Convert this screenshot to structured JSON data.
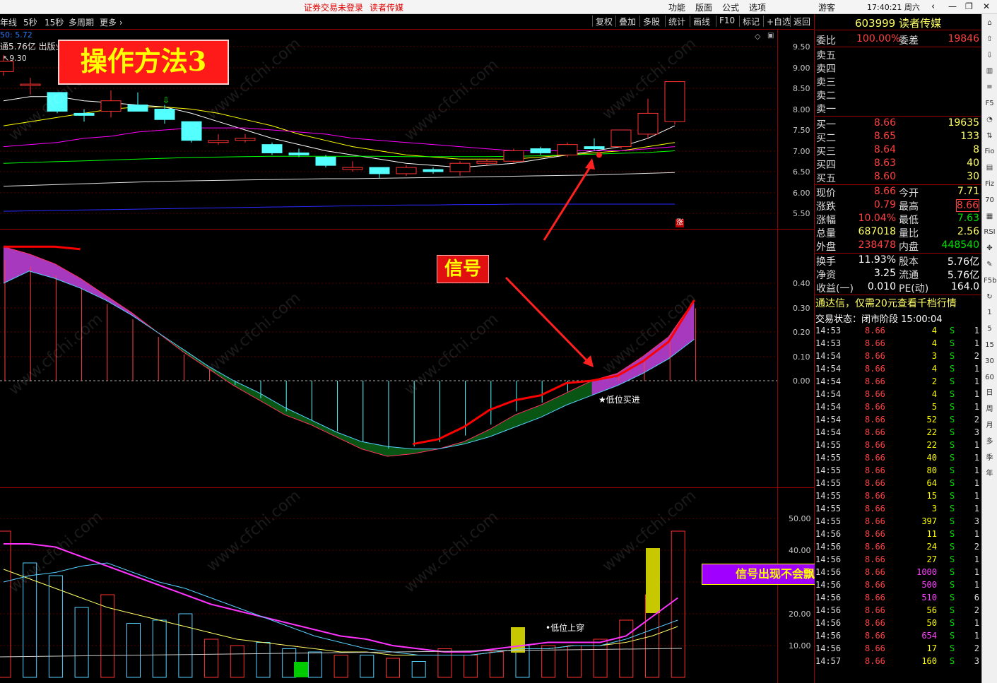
{
  "topbar": {
    "login_status": "证券交易未登录",
    "stock_short": "读者传媒",
    "menu": [
      "功能",
      "版面",
      "公式",
      "选项"
    ],
    "user": "游客",
    "clock": "17:40:21 周六"
  },
  "toolbar": {
    "left_items": [
      "年线",
      "5秒",
      "15秒",
      "多周期",
      "更多 ›"
    ],
    "right_items": [
      "复权",
      "叠加",
      "多股",
      "统计",
      "画线",
      "F10",
      "标记",
      "+自选",
      "返回"
    ]
  },
  "chart_header": {
    "line1": "50: 5.72",
    "line2": "通5.76亿 出版业",
    "line3": "9.30"
  },
  "annotations": {
    "title": "操作方法3",
    "signal": "信号",
    "buy_label": "★低位买进",
    "cross_label": "•低位上穿",
    "caption": "信号出现不会飘移，然后观察成交量的变化",
    "limit_up_mark": "涨"
  },
  "watermark": "www.cfchi.com",
  "colors": {
    "up": "#ff3232",
    "down": "#54ffff",
    "green": "#00ff00",
    "yellow": "#ffff00",
    "magenta": "#ff00ff",
    "purple_band": "#b03cc8",
    "green_band": "#0a5a14",
    "panel_red": "#9b0000"
  },
  "price_axis": [
    "9.50",
    "9.00",
    "8.50",
    "8.00",
    "7.50",
    "7.00",
    "6.50",
    "6.00",
    "5.50"
  ],
  "macd_axis": [
    "0.40",
    "0.30",
    "0.20",
    "0.10",
    "0.00"
  ],
  "vol_axis": [
    "50.00",
    "40.00",
    "30.00",
    "20.00",
    "10.00"
  ],
  "chart_data": {
    "type": "candlestick",
    "candles": [
      {
        "o": 8.9,
        "c": 9.15,
        "h": 9.3,
        "l": 8.8
      },
      {
        "o": 8.6,
        "c": 8.6,
        "h": 8.75,
        "l": 8.35
      },
      {
        "o": 8.4,
        "c": 7.95,
        "h": 8.4,
        "l": 7.9
      },
      {
        "o": 7.9,
        "c": 7.85,
        "h": 8.0,
        "l": 7.7
      },
      {
        "o": 7.95,
        "c": 8.2,
        "h": 8.45,
        "l": 7.8
      },
      {
        "o": 8.1,
        "c": 7.95,
        "h": 8.4,
        "l": 7.95
      },
      {
        "o": 8.0,
        "c": 7.75,
        "h": 8.1,
        "l": 7.65
      },
      {
        "o": 7.7,
        "c": 7.25,
        "h": 7.7,
        "l": 7.2
      },
      {
        "o": 7.2,
        "c": 7.25,
        "h": 7.4,
        "l": 7.15
      },
      {
        "o": 7.25,
        "c": 7.3,
        "h": 7.4,
        "l": 7.2
      },
      {
        "o": 7.15,
        "c": 6.95,
        "h": 7.2,
        "l": 6.9
      },
      {
        "o": 6.95,
        "c": 6.9,
        "h": 7.05,
        "l": 6.85
      },
      {
        "o": 6.85,
        "c": 6.65,
        "h": 6.9,
        "l": 6.6
      },
      {
        "o": 6.55,
        "c": 6.6,
        "h": 6.75,
        "l": 6.5
      },
      {
        "o": 6.6,
        "c": 6.45,
        "h": 6.6,
        "l": 6.35
      },
      {
        "o": 6.45,
        "c": 6.6,
        "h": 6.65,
        "l": 6.4
      },
      {
        "o": 6.55,
        "c": 6.5,
        "h": 6.6,
        "l": 6.45
      },
      {
        "o": 6.5,
        "c": 6.7,
        "h": 6.75,
        "l": 6.4
      },
      {
        "o": 6.7,
        "c": 6.75,
        "h": 6.8,
        "l": 6.65
      },
      {
        "o": 6.75,
        "c": 7.0,
        "h": 7.05,
        "l": 6.7
      },
      {
        "o": 7.05,
        "c": 6.95,
        "h": 7.1,
        "l": 6.9
      },
      {
        "o": 6.9,
        "c": 7.15,
        "h": 7.2,
        "l": 6.85
      },
      {
        "o": 7.1,
        "c": 7.05,
        "h": 7.3,
        "l": 7.0
      },
      {
        "o": 7.1,
        "c": 7.5,
        "h": 7.5,
        "l": 7.05
      },
      {
        "o": 7.4,
        "c": 7.9,
        "h": 8.25,
        "l": 7.3
      },
      {
        "o": 7.7,
        "c": 8.66,
        "h": 8.66,
        "l": 7.63
      }
    ],
    "ma": [
      {
        "color": "#ffffff",
        "values": [
          8.2,
          8.3,
          8.3,
          8.2,
          8.15,
          8.1,
          8.05,
          7.9,
          7.7,
          7.5,
          7.3,
          7.15,
          7.0,
          6.9,
          6.8,
          6.7,
          6.65,
          6.6,
          6.65,
          6.7,
          6.8,
          6.9,
          7.0,
          7.1,
          7.3,
          7.6
        ]
      },
      {
        "color": "#ffff00",
        "values": [
          7.6,
          7.7,
          7.8,
          7.9,
          8.0,
          8.05,
          8.05,
          8.0,
          7.9,
          7.75,
          7.6,
          7.4,
          7.25,
          7.1,
          7.0,
          6.9,
          6.85,
          6.8,
          6.8,
          6.8,
          6.85,
          6.9,
          6.95,
          7.0,
          7.1,
          7.2
        ]
      },
      {
        "color": "#ff00ff",
        "values": [
          7.1,
          7.15,
          7.2,
          7.3,
          7.35,
          7.45,
          7.5,
          7.55,
          7.55,
          7.55,
          7.5,
          7.45,
          7.4,
          7.3,
          7.25,
          7.2,
          7.15,
          7.1,
          7.05,
          7.0,
          7.0,
          7.0,
          7.0,
          7.0,
          7.05,
          7.1
        ]
      },
      {
        "color": "#00ff00",
        "values": [
          6.7,
          6.72,
          6.74,
          6.76,
          6.78,
          6.8,
          6.82,
          6.84,
          6.85,
          6.86,
          6.87,
          6.87,
          6.87,
          6.87,
          6.87,
          6.86,
          6.86,
          6.86,
          6.86,
          6.87,
          6.88,
          6.9,
          6.92,
          6.94,
          6.96,
          7.0
        ]
      },
      {
        "color": "#e0e0e0",
        "values": [
          6.15,
          6.17,
          6.19,
          6.21,
          6.23,
          6.25,
          6.27,
          6.28,
          6.29,
          6.3,
          6.31,
          6.32,
          6.33,
          6.33,
          6.34,
          6.35,
          6.36,
          6.37,
          6.38,
          6.39,
          6.4,
          6.41,
          6.42,
          6.44,
          6.46,
          6.48
        ]
      },
      {
        "color": "#2a2aff",
        "values": [
          5.55,
          5.56,
          5.57,
          5.58,
          5.59,
          5.6,
          5.61,
          5.62,
          5.63,
          5.64,
          5.65,
          5.66,
          5.67,
          5.68,
          5.69,
          5.7,
          5.7,
          5.71,
          5.71,
          5.72,
          5.72,
          5.72,
          5.72,
          5.72,
          5.72,
          5.72
        ]
      }
    ],
    "macd": {
      "red_line": [
        0.55,
        0.52,
        0.48,
        0.42,
        0.35,
        0.28,
        0.2,
        0.12,
        0.05,
        -0.02,
        -0.08,
        -0.14,
        -0.18,
        -0.23,
        -0.28,
        -0.31,
        -0.3,
        -0.28,
        -0.25,
        -0.2,
        -0.14,
        -0.1,
        -0.05,
        0.0,
        0.03,
        0.1,
        0.18,
        0.33
      ],
      "cyan_line": [
        0.4,
        0.45,
        0.42,
        0.38,
        0.33,
        0.27,
        0.2,
        0.13,
        0.06,
        0.0,
        -0.05,
        -0.11,
        -0.16,
        -0.21,
        -0.25,
        -0.27,
        -0.28,
        -0.28,
        -0.26,
        -0.23,
        -0.19,
        -0.15,
        -0.1,
        -0.06,
        -0.02,
        0.03,
        0.09,
        0.17
      ],
      "thick_red": [
        0.55,
        0.55,
        0.55,
        0.54
      ],
      "signal_line": [
        -0.26,
        -0.24,
        -0.19,
        -0.12,
        -0.08,
        -0.06,
        -0.01,
        0.0,
        0.02,
        0.08,
        0.16,
        0.33
      ]
    },
    "volume": {
      "bars": [
        {
          "v": 46,
          "up": true
        },
        {
          "v": 36,
          "up": false
        },
        {
          "v": 32,
          "up": false
        },
        {
          "v": 22,
          "up": false
        },
        {
          "v": 26,
          "up": true
        },
        {
          "v": 17,
          "up": false
        },
        {
          "v": 18,
          "up": false
        },
        {
          "v": 20,
          "up": false
        },
        {
          "v": 12,
          "up": true
        },
        {
          "v": 10,
          "up": true
        },
        {
          "v": 11,
          "up": false
        },
        {
          "v": 9,
          "up": false
        },
        {
          "v": 8,
          "up": false
        },
        {
          "v": 7,
          "up": true
        },
        {
          "v": 7,
          "up": false
        },
        {
          "v": 6,
          "up": true
        },
        {
          "v": 5,
          "up": false
        },
        {
          "v": 9,
          "up": true
        },
        {
          "v": 7,
          "up": true
        },
        {
          "v": 8,
          "up": true
        },
        {
          "v": 10,
          "up": false
        },
        {
          "v": 10,
          "up": true
        },
        {
          "v": 10,
          "up": true
        },
        {
          "v": 12,
          "up": true
        },
        {
          "v": 18,
          "up": true
        },
        {
          "v": 26,
          "up": true
        },
        {
          "v": 46,
          "up": true
        }
      ],
      "ma_magenta": [
        42,
        42,
        41,
        38,
        35,
        32,
        29,
        26,
        23,
        21,
        19,
        17,
        15,
        13,
        12,
        10,
        9,
        8,
        8,
        9,
        10,
        11,
        11,
        11,
        13,
        19,
        25
      ],
      "ma_yellow": [
        34,
        31,
        28,
        25,
        22,
        20,
        18,
        16,
        14,
        12,
        11,
        10,
        9,
        8,
        8,
        7,
        7,
        7,
        7,
        8,
        9,
        9,
        10,
        10,
        11,
        13,
        16
      ],
      "ma_cyan": [
        30,
        32,
        33,
        35,
        36,
        33,
        30,
        28,
        25,
        22,
        19,
        16,
        13,
        11,
        9,
        8,
        7,
        7,
        7,
        8,
        9,
        9,
        10,
        10,
        12,
        15,
        18
      ]
    }
  },
  "quote": {
    "code": "603999",
    "name": "读者传媒",
    "weibi_label": "委比",
    "weibi": "100.00%",
    "weicha_label": "委差",
    "weicha": "19846",
    "sells": [
      {
        "label": "卖五"
      },
      {
        "label": "卖四"
      },
      {
        "label": "卖三"
      },
      {
        "label": "卖二"
      },
      {
        "label": "卖一"
      }
    ],
    "buys": [
      {
        "label": "买一",
        "price": "8.66",
        "vol": "19635"
      },
      {
        "label": "买二",
        "price": "8.65",
        "vol": "133"
      },
      {
        "label": "买三",
        "price": "8.64",
        "vol": "8"
      },
      {
        "label": "买四",
        "price": "8.63",
        "vol": "40"
      },
      {
        "label": "买五",
        "price": "8.60",
        "vol": "30"
      }
    ],
    "stats": [
      {
        "l1": "现价",
        "v1": "8.66",
        "l2": "今开",
        "v2": "7.71"
      },
      {
        "l1": "涨跌",
        "v1": "0.79",
        "l2": "最高",
        "v2": "8.66"
      },
      {
        "l1": "涨幅",
        "v1": "10.04%",
        "l2": "最低",
        "v2": "7.63"
      },
      {
        "l1": "总量",
        "v1": "687018",
        "l2": "量比",
        "v2": "2.56"
      },
      {
        "l1": "外盘",
        "v1": "238478",
        "l2": "内盘",
        "v2": "448540"
      }
    ],
    "stats2": [
      {
        "l1": "换手",
        "v1": "11.93%",
        "l2": "股本",
        "v2": "5.76亿"
      },
      {
        "l1": "净资",
        "v1": "3.25",
        "l2": "流通",
        "v2": "5.76亿"
      },
      {
        "l1": "收益(一)",
        "v1": "0.010",
        "l2": "PE(动)",
        "v2": "164.0"
      }
    ],
    "promo": "通达信，仅需20元查看千档行情",
    "trade_status_label": "交易状态：闭市阶段",
    "trade_status_time": "15:00:04",
    "ticks": [
      {
        "t": "14:53",
        "p": "8.66",
        "v": "4",
        "bs": "S",
        "n": "1",
        "c": "#ffff00"
      },
      {
        "t": "14:53",
        "p": "8.66",
        "v": "4",
        "bs": "S",
        "n": "1",
        "c": "#ffff00"
      },
      {
        "t": "14:54",
        "p": "8.66",
        "v": "3",
        "bs": "S",
        "n": "2",
        "c": "#ffff00"
      },
      {
        "t": "14:54",
        "p": "8.66",
        "v": "4",
        "bs": "S",
        "n": "1",
        "c": "#ffff00"
      },
      {
        "t": "14:54",
        "p": "8.66",
        "v": "2",
        "bs": "S",
        "n": "1",
        "c": "#ffff00"
      },
      {
        "t": "14:54",
        "p": "8.66",
        "v": "4",
        "bs": "S",
        "n": "1",
        "c": "#ffff00"
      },
      {
        "t": "14:54",
        "p": "8.66",
        "v": "5",
        "bs": "S",
        "n": "1",
        "c": "#ffff00"
      },
      {
        "t": "14:54",
        "p": "8.66",
        "v": "52",
        "bs": "S",
        "n": "2",
        "c": "#ffff00"
      },
      {
        "t": "14:54",
        "p": "8.66",
        "v": "22",
        "bs": "S",
        "n": "3",
        "c": "#ffff00"
      },
      {
        "t": "14:55",
        "p": "8.66",
        "v": "22",
        "bs": "S",
        "n": "1",
        "c": "#ffff00"
      },
      {
        "t": "14:55",
        "p": "8.66",
        "v": "40",
        "bs": "S",
        "n": "1",
        "c": "#ffff00"
      },
      {
        "t": "14:55",
        "p": "8.66",
        "v": "80",
        "bs": "S",
        "n": "1",
        "c": "#ffff00"
      },
      {
        "t": "14:55",
        "p": "8.66",
        "v": "64",
        "bs": "S",
        "n": "1",
        "c": "#ffff00"
      },
      {
        "t": "14:55",
        "p": "8.66",
        "v": "15",
        "bs": "S",
        "n": "1",
        "c": "#ffff00"
      },
      {
        "t": "14:55",
        "p": "8.66",
        "v": "3",
        "bs": "S",
        "n": "1",
        "c": "#ffff00"
      },
      {
        "t": "14:55",
        "p": "8.66",
        "v": "397",
        "bs": "S",
        "n": "3",
        "c": "#ffff00"
      },
      {
        "t": "14:56",
        "p": "8.66",
        "v": "11",
        "bs": "S",
        "n": "1",
        "c": "#ffff00"
      },
      {
        "t": "14:56",
        "p": "8.66",
        "v": "24",
        "bs": "S",
        "n": "2",
        "c": "#ffff00"
      },
      {
        "t": "14:56",
        "p": "8.66",
        "v": "27",
        "bs": "S",
        "n": "1",
        "c": "#ffff00"
      },
      {
        "t": "14:56",
        "p": "8.66",
        "v": "1000",
        "bs": "S",
        "n": "1",
        "c": "#ff40ff"
      },
      {
        "t": "14:56",
        "p": "8.66",
        "v": "500",
        "bs": "S",
        "n": "1",
        "c": "#ff40ff"
      },
      {
        "t": "14:56",
        "p": "8.66",
        "v": "510",
        "bs": "S",
        "n": "6",
        "c": "#ff40ff"
      },
      {
        "t": "14:56",
        "p": "8.66",
        "v": "56",
        "bs": "S",
        "n": "2",
        "c": "#ffff00"
      },
      {
        "t": "14:56",
        "p": "8.66",
        "v": "50",
        "bs": "S",
        "n": "1",
        "c": "#ffff00"
      },
      {
        "t": "14:56",
        "p": "8.66",
        "v": "654",
        "bs": "S",
        "n": "1",
        "c": "#ff40ff"
      },
      {
        "t": "14:56",
        "p": "8.66",
        "v": "17",
        "bs": "S",
        "n": "2",
        "c": "#ffff00"
      },
      {
        "t": "14:57",
        "p": "8.66",
        "v": "160",
        "bs": "S",
        "n": "3",
        "c": "#ffff00"
      }
    ]
  },
  "side_icons": [
    "home-icon",
    "back-icon",
    "forward-icon",
    "chart-icon",
    "list-icon",
    "F5",
    "pie-icon",
    "compare-icon",
    "Fio",
    "doc-icon",
    "Fiz",
    "70",
    "grid-icon",
    "RSI",
    "pan-icon",
    "pencil-icon",
    "F5b",
    "rotate-icon",
    "1",
    "5",
    "15",
    "30",
    "60",
    "日",
    "周",
    "月",
    "多",
    "季",
    "年"
  ]
}
